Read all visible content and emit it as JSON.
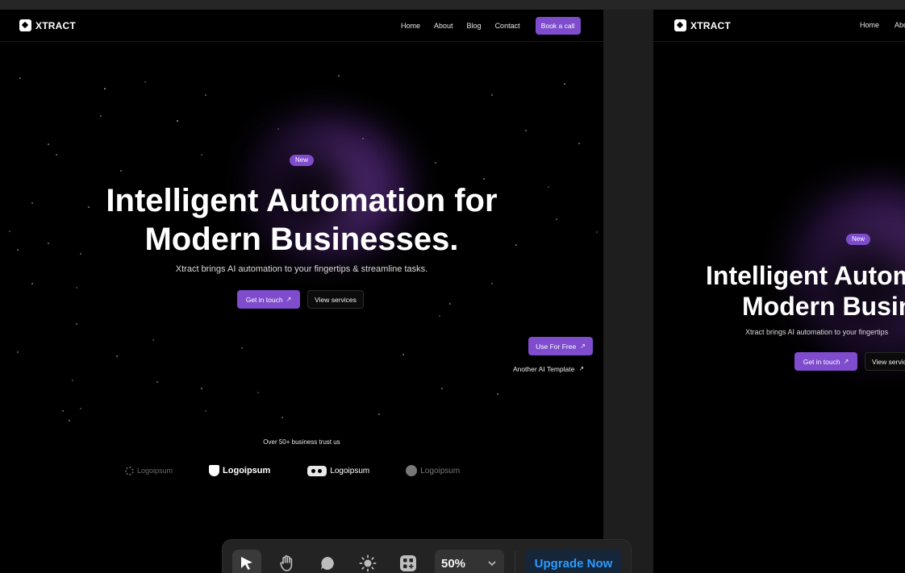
{
  "site": {
    "brand": "XTRACT",
    "nav": [
      "Home",
      "About",
      "Blog",
      "Contact"
    ],
    "nav_cta": "Book a call",
    "badge": "New",
    "headline_line1": "Intelligent Automation for",
    "headline_line2": "Modern Businesses.",
    "subtitle": "Xtract brings AI automation to your fingertips & streamline tasks.",
    "primary_cta": "Get in touch",
    "secondary_cta": "View services",
    "trust_text": "Over 50+ business trust us",
    "logos": [
      "Logoipsum",
      "Logoipsum",
      "Logoipsum",
      "Logoipsum"
    ]
  },
  "frame_b": {
    "brand": "XTRACT",
    "nav": [
      "Home",
      "Abo"
    ],
    "badge": "New",
    "headline_line1": "Intelligent Autom",
    "headline_line2": "Modern Busin",
    "subtitle": "Xtract brings AI automation to your fingertips",
    "primary_cta": "Get in touch",
    "secondary_cta": "View servic"
  },
  "template_links": {
    "use_free": "Use For Free",
    "another": "Another AI Template"
  },
  "toolbar": {
    "tools": [
      "select-icon",
      "hand-icon",
      "comment-icon",
      "brightness-icon",
      "components-icon"
    ],
    "zoom": "50%",
    "upgrade": "Upgrade Now"
  },
  "colors": {
    "accent_purple": "#7e4ccd",
    "upgrade_text": "#2b9bff",
    "canvas_bg": "#1e1e1e"
  }
}
